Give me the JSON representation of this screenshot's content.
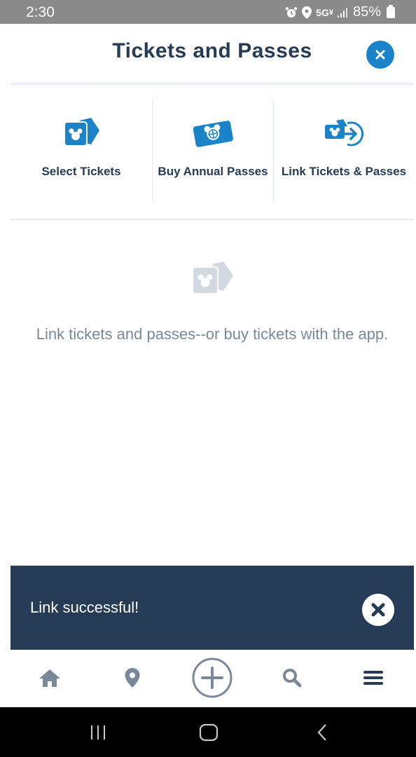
{
  "status_bar": {
    "time": "2:30",
    "network": "5G",
    "network_sub": "¥",
    "battery": "85%"
  },
  "header": {
    "title": "Tickets and Passes"
  },
  "actions": [
    {
      "label": "Select Tickets",
      "icon": "ticket-mickey-icon"
    },
    {
      "label": "Buy Annual Passes",
      "icon": "annual-pass-globe-icon"
    },
    {
      "label": "Link Tickets & Passes",
      "icon": "link-ticket-arrow-icon"
    }
  ],
  "empty_state": {
    "text": "Link tickets and passes--or buy tickets with the app."
  },
  "toast": {
    "message": "Link successful!"
  },
  "bottom_nav": [
    {
      "name": "home",
      "icon": "home-icon"
    },
    {
      "name": "map",
      "icon": "location-pin-icon"
    },
    {
      "name": "add",
      "icon": "plus-circle-icon"
    },
    {
      "name": "search",
      "icon": "search-icon"
    },
    {
      "name": "menu",
      "icon": "hamburger-menu-icon"
    }
  ],
  "colors": {
    "primary_navy": "#253b56",
    "accent_blue": "#1b84c8",
    "muted_gray": "#7b8899",
    "icon_gray": "#d3d9e0"
  }
}
